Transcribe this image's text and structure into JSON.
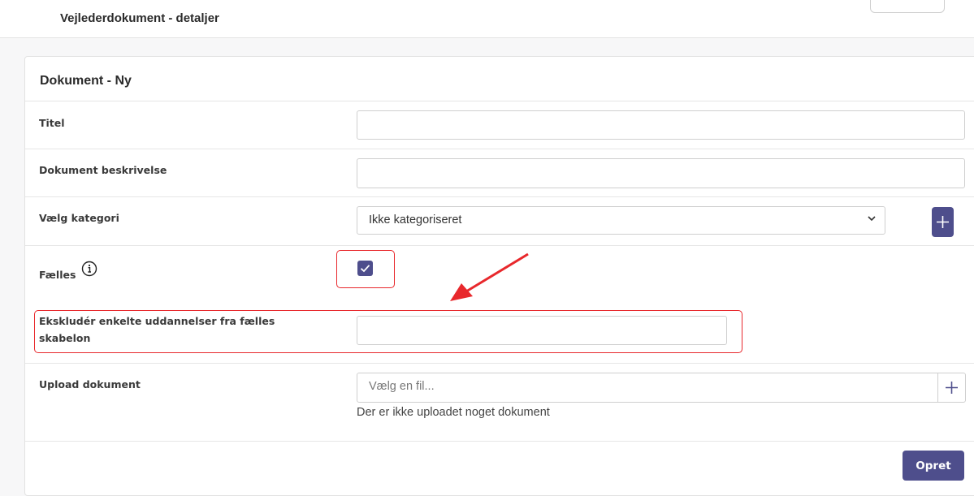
{
  "header": {
    "title": "Vejlederdokument - detaljer"
  },
  "card": {
    "title": "Dokument - Ny"
  },
  "form": {
    "titel": {
      "label": "Titel",
      "value": ""
    },
    "beskrivelse": {
      "label": "Dokument beskrivelse",
      "value": ""
    },
    "kategori": {
      "label": "Vælg kategori",
      "selected": "Ikke kategoriseret"
    },
    "faelles": {
      "label": "Fælles",
      "checked": true
    },
    "ekskluder": {
      "label": "Ekskludér enkelte uddannelser fra fælles skabelon",
      "value": ""
    },
    "upload": {
      "label": "Upload dokument",
      "placeholder": "Vælg en fil...",
      "helper": "Der er ikke uploadet noget dokument"
    }
  },
  "actions": {
    "submit_label": "Opret"
  },
  "icons": {
    "add": "plus-icon",
    "info": "info-icon",
    "check": "check-icon",
    "dropdown": "chevron-down-icon"
  },
  "colors": {
    "primary": "#4e4e8c",
    "annotation": "#e8282c",
    "border": "#cfcfcf"
  }
}
